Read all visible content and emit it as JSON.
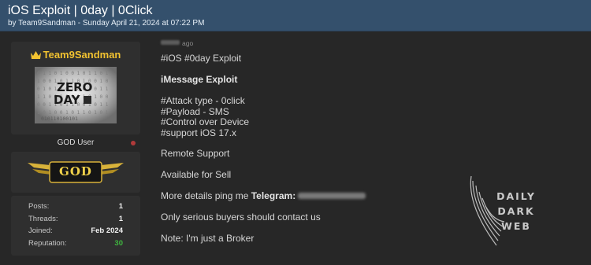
{
  "thread": {
    "title": "iOS Exploit | 0day | 0Click",
    "meta": "by Team9Sandman - Sunday April 21, 2024 at 07:22 PM"
  },
  "user": {
    "name": "Team9Sandman",
    "avatar_text_line1": "ZERO",
    "avatar_text_line2": "DAY",
    "avatar_code": "010110100101",
    "title": "GOD User",
    "rank": "GOD",
    "stats": [
      {
        "label": "Posts:",
        "value": "1"
      },
      {
        "label": "Threads:",
        "value": "1"
      },
      {
        "label": "Joined:",
        "value": "Feb 2024"
      },
      {
        "label": "Reputation:",
        "value": "30"
      }
    ],
    "colors": {
      "username": "#f2c230",
      "reputation": "#3fb53f"
    }
  },
  "post": {
    "time_suffix": "ago",
    "lines": [
      "#iOS #0day Exploit",
      "iMessage Exploit",
      "#Attack type - 0click",
      "#Payload - SMS",
      "#Control over Device",
      "#support iOS 17.x",
      "Remote Support",
      "Available for Sell",
      "More details ping me",
      "Telegram:",
      "Only serious buyers should contact us",
      "Note: I'm just a Broker"
    ]
  },
  "watermark": {
    "line1": "DAILY",
    "line2": "DARK",
    "line3": "WEB"
  }
}
